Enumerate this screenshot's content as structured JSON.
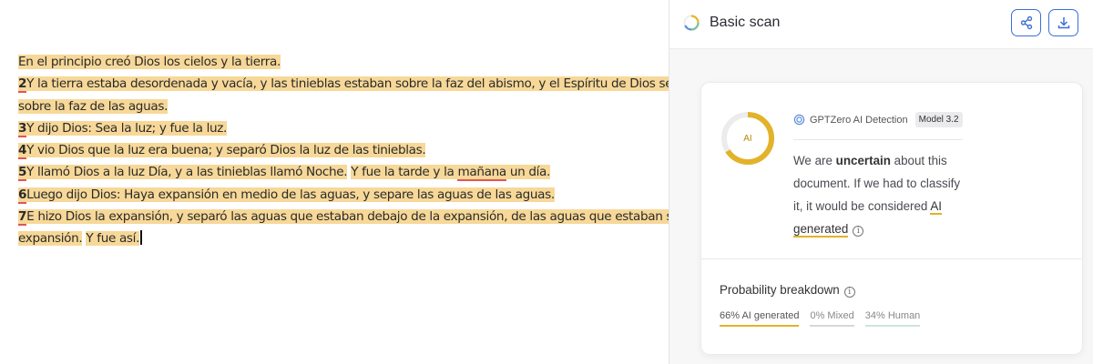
{
  "editor": {
    "lines": [
      [
        {
          "t": "En el principio creó Dios los cielos y la tierra.",
          "c": "hl"
        }
      ],
      [
        {
          "t": "2",
          "c": "hl num"
        },
        {
          "t": "Y la tierra estaba desordenada y vacía, y las tinieblas estaban sobre la faz del abismo, y el Espíritu de Dios se movía",
          "c": "hl"
        }
      ],
      [
        {
          "t": "sobre la faz de las aguas.",
          "c": "hl"
        }
      ],
      [
        {
          "t": "3",
          "c": "hl num"
        },
        {
          "t": "Y dijo Dios: Sea la luz; y fue la luz.",
          "c": "hl"
        }
      ],
      [
        {
          "t": "4",
          "c": "hl num"
        },
        {
          "t": "Y vio Dios que la luz era buena; y separó Dios la luz de las tinieblas.",
          "c": "hl"
        }
      ],
      [
        {
          "t": "5",
          "c": "hl num"
        },
        {
          "t": "Y llamó Dios a la luz Día, y a las tinieblas llamó Noche.",
          "c": "hl"
        },
        {
          "t": " ",
          "c": ""
        },
        {
          "t": "Y fue la tarde y la ",
          "c": "hl"
        },
        {
          "t": "mañana",
          "c": "hl err"
        },
        {
          "t": " un día.",
          "c": "hl"
        }
      ],
      [
        {
          "t": "6",
          "c": "hl num"
        },
        {
          "t": "Luego dijo Dios: Haya expansión en medio de las aguas, y separe las aguas de las aguas.",
          "c": "hl"
        }
      ],
      [
        {
          "t": "7",
          "c": "hl num"
        },
        {
          "t": "E hizo Dios la expansión, y separó las aguas que estaban debajo de la expansión, de las aguas que estaban sobre la",
          "c": "hl"
        }
      ],
      [
        {
          "t": "expansión.",
          "c": "hl"
        },
        {
          "t": " ",
          "c": ""
        },
        {
          "t": "Y fue así.",
          "c": "hl"
        }
      ]
    ]
  },
  "panel": {
    "title": "Basic scan",
    "share_icon": "share-icon",
    "download_icon": "download-icon",
    "spinner_icon": "loading-ring-icon",
    "detection_label": "GPTZero AI Detection",
    "model_badge": "Model 3.2",
    "donut_label": "AI",
    "donut_fraction": 0.66,
    "verdict_parts": {
      "p1": "We are ",
      "p2": "uncertain",
      "p3": " about this document. If we had to classify it, it would be considered ",
      "p4": "AI generated"
    },
    "probability_title": "Probability breakdown",
    "probabilities": {
      "ai": "66% AI generated",
      "mixed": "0% Mixed",
      "human": "34% Human"
    },
    "colors": {
      "accent_ai": "#e2b328",
      "highlight": "#f7d898",
      "button_border": "#3b6fd8",
      "human": "#cfe3dd"
    }
  }
}
